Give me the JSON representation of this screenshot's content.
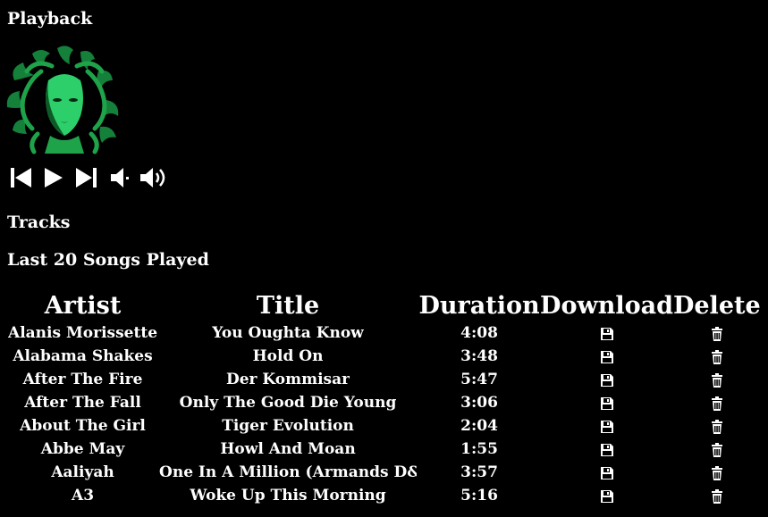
{
  "headings": {
    "playback": "Playback",
    "tracks": "Tracks",
    "last_played": "Last 20 Songs Played"
  },
  "album_art": {
    "icon": "medusa-album-art",
    "accent": "#1fa34a"
  },
  "controls": [
    {
      "name": "previous-button",
      "icon": "skip-back-icon"
    },
    {
      "name": "play-button",
      "icon": "play-icon"
    },
    {
      "name": "next-button",
      "icon": "skip-forward-icon"
    },
    {
      "name": "volume-down-button",
      "icon": "volume-low-icon"
    },
    {
      "name": "volume-up-button",
      "icon": "volume-high-icon"
    }
  ],
  "table": {
    "columns": [
      "Artist",
      "Title",
      "Duration",
      "Download",
      "Delete"
    ],
    "rows": [
      {
        "artist": "Alanis Morissette",
        "title": "You Oughta Know",
        "duration": "4:08"
      },
      {
        "artist": "Alabama Shakes",
        "title": "Hold On",
        "duration": "3:48"
      },
      {
        "artist": "After The Fire",
        "title": "Der Kommisar",
        "duration": "5:47"
      },
      {
        "artist": "After The Fall",
        "title": "Only The Good Die Young",
        "duration": "3:06"
      },
      {
        "artist": "About The Girl",
        "title": "Tiger Evolution",
        "duration": "2:04"
      },
      {
        "artist": "Abbe May",
        "title": "Howl And Moan",
        "duration": "1:55"
      },
      {
        "artist": "Aaliyah",
        "title": "One In A Million (Armands D&b",
        "duration": "3:57"
      },
      {
        "artist": "A3",
        "title": "Woke Up This Morning",
        "duration": "5:16"
      }
    ],
    "download_icon": "floppy-disk-icon",
    "delete_icon": "trash-icon"
  }
}
